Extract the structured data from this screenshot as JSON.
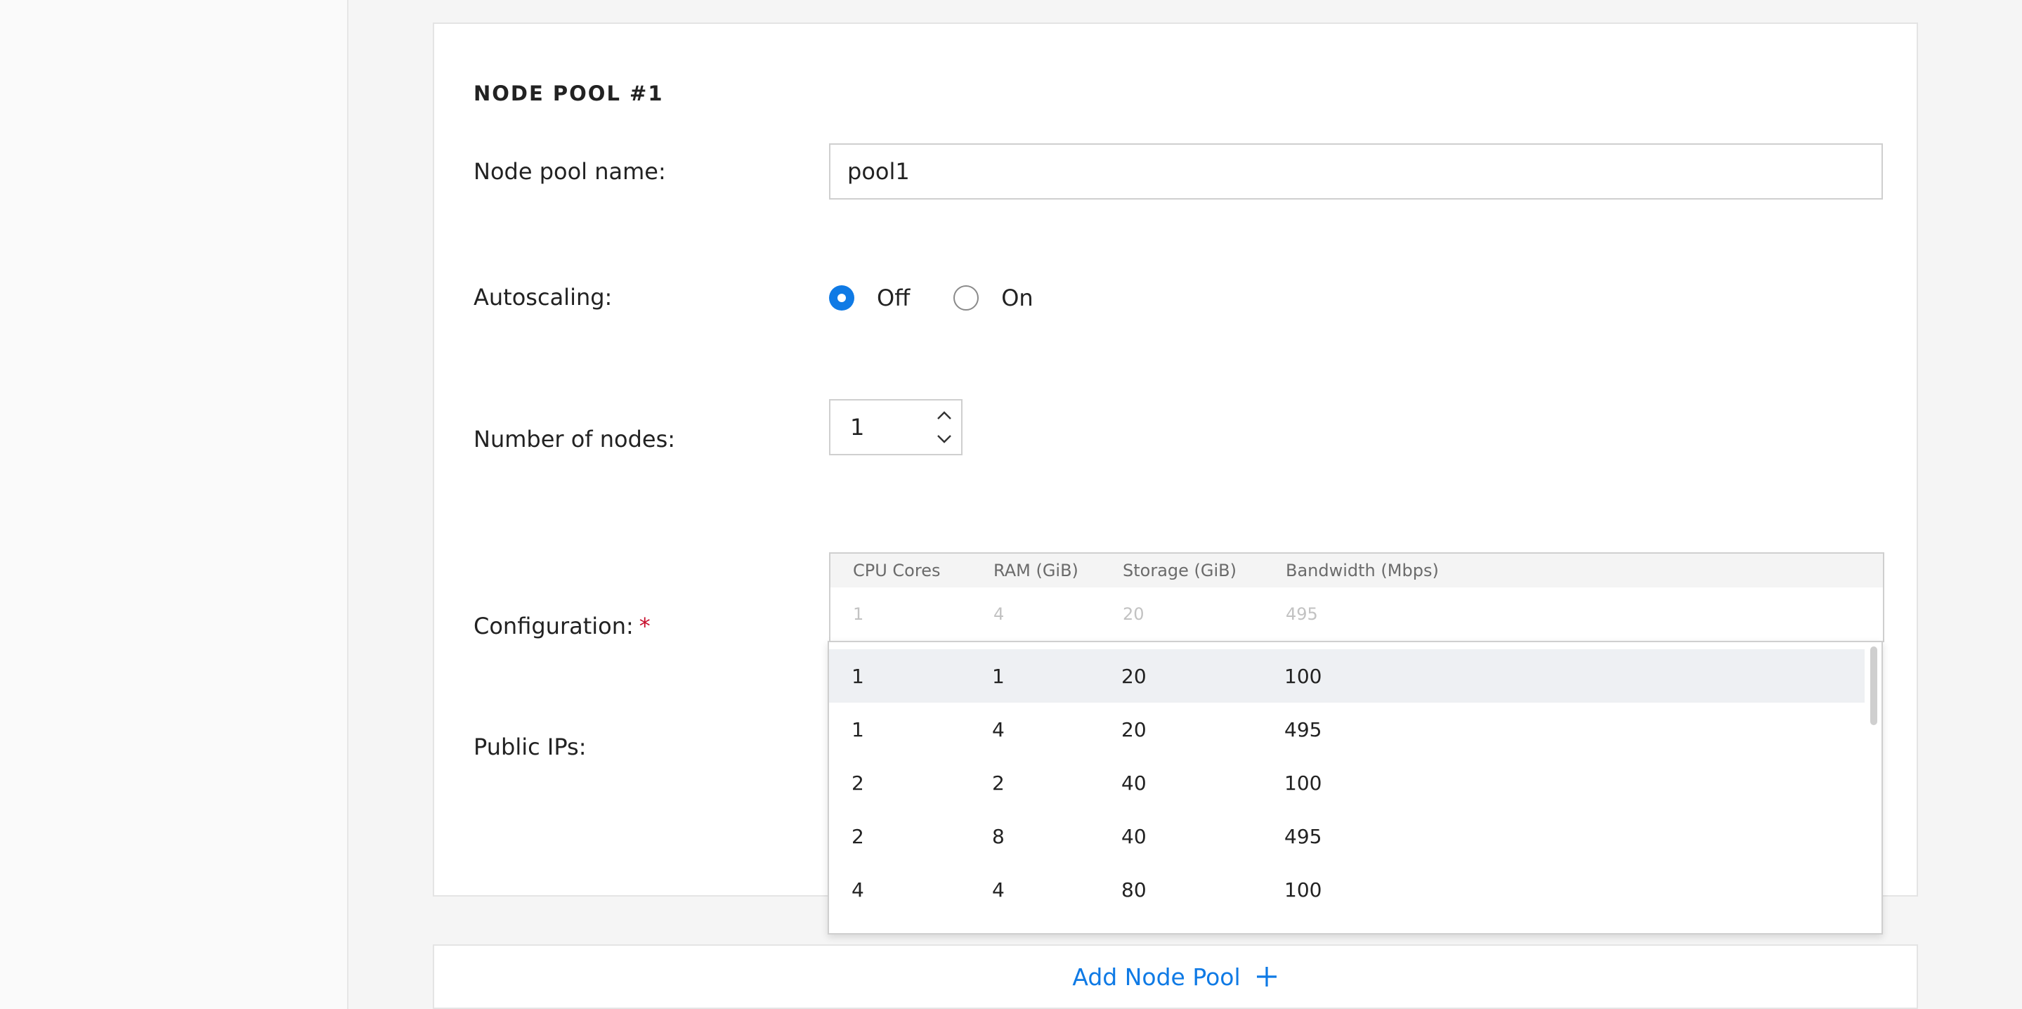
{
  "node_pool": {
    "title": "NODE POOL #1",
    "name_label": "Node pool name:",
    "name_value": "pool1",
    "autoscaling_label": "Autoscaling:",
    "autoscaling_options": [
      "Off",
      "On"
    ],
    "autoscaling_selected": "Off",
    "nodes_label": "Number of nodes:",
    "nodes_value": "1",
    "configuration_label": "Configuration:",
    "required_mark": "*",
    "public_ips_label": "Public IPs:"
  },
  "configuration": {
    "columns": [
      "CPU Cores",
      "RAM (GiB)",
      "Storage (GiB)",
      "Bandwidth (Mbps)"
    ],
    "current": [
      "1",
      "4",
      "20",
      "495"
    ],
    "options": [
      [
        "1",
        "1",
        "20",
        "100"
      ],
      [
        "1",
        "4",
        "20",
        "495"
      ],
      [
        "2",
        "2",
        "40",
        "100"
      ],
      [
        "2",
        "8",
        "40",
        "495"
      ],
      [
        "4",
        "4",
        "80",
        "100"
      ]
    ]
  },
  "actions": {
    "add_node_pool": "Add Node Pool"
  },
  "colors": {
    "accent": "#0f7ae5",
    "required": "#c8102e",
    "highlight_row": "#eef0f3"
  }
}
